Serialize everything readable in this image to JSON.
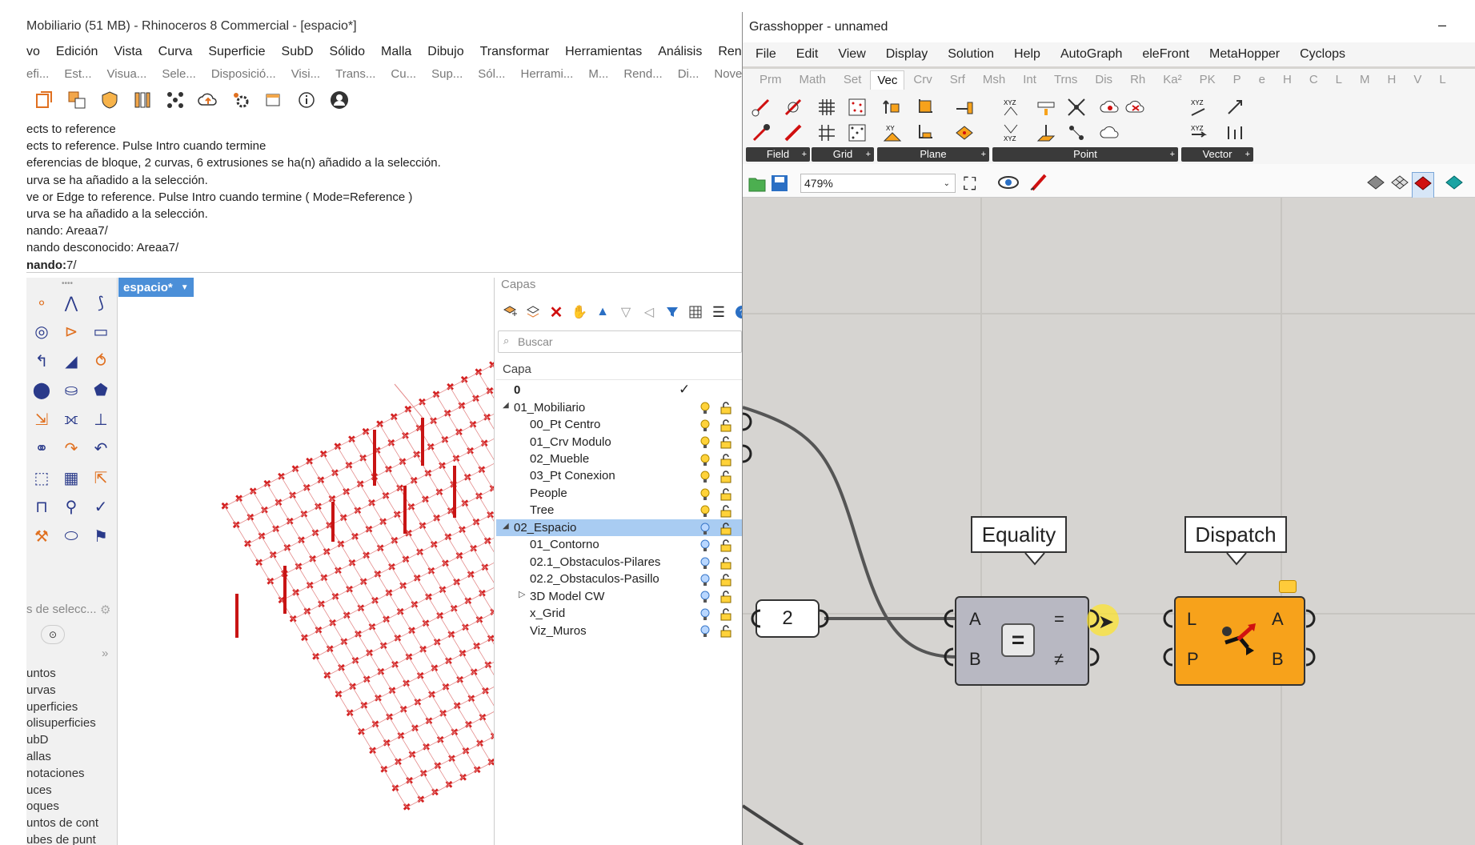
{
  "rhino": {
    "title": "Mobiliario (51 MB) - Rhinoceros 8 Commercial - [espacio*]",
    "menu": [
      "vo",
      "Edición",
      "Vista",
      "Curva",
      "Superficie",
      "SubD",
      "Sólido",
      "Malla",
      "Dibujo",
      "Transformar",
      "Herramientas",
      "Análisis",
      "Renderizac"
    ],
    "toolbar_tabs": [
      "efi...",
      "Est...",
      "Visua...",
      "Sele...",
      "Disposició...",
      "Visi...",
      "Trans...",
      "Cu...",
      "Sup...",
      "Sól...",
      "Herrami...",
      "M...",
      "Rend...",
      "Di...",
      "Nove"
    ],
    "command_log": [
      "ects to reference",
      "ects to reference. Pulse Intro cuando termine",
      "eferencias de bloque, 2 curvas, 6 extrusiones se ha(n) añadido a la selección.",
      "urva se ha añadido a la selección.",
      "ve or Edge to reference. Pulse Intro cuando termine ( Mode=Reference )",
      "urva se ha añadido a la selección.",
      "nando: Areaa7/",
      "nando desconocido: Areaa7/"
    ],
    "command_prompt_label": "nando:",
    "command_prompt_value": "7/",
    "viewport_tab": "espacio*",
    "selection_filter_header": "s de selecc...",
    "selection_items": [
      "untos",
      "urvas",
      "uperficies",
      "olisuperficies",
      "ubD",
      "allas",
      "notaciones",
      "uces",
      "oques",
      "untos de cont",
      "ubes de punt"
    ]
  },
  "layers": {
    "panel_title": "Capas",
    "search_placeholder": "Buscar",
    "column_header": "Capa",
    "rows": [
      {
        "name": "0",
        "current": true
      },
      {
        "name": "01_Mobiliario",
        "expanded": true
      },
      {
        "name": "00_Pt Centro"
      },
      {
        "name": "01_Crv Modulo"
      },
      {
        "name": "02_Mueble"
      },
      {
        "name": "03_Pt Conexion"
      },
      {
        "name": "People"
      },
      {
        "name": "Tree"
      },
      {
        "name": "02_Espacio",
        "expanded": true,
        "selected": true
      },
      {
        "name": "01_Contorno"
      },
      {
        "name": "02.1_Obstaculos-Pilares"
      },
      {
        "name": "02.2_Obstaculos-Pasillo"
      },
      {
        "name": "3D Model CW",
        "collapsed": true
      },
      {
        "name": "x_Grid"
      },
      {
        "name": "Viz_Muros"
      }
    ],
    "checkmark": "✓"
  },
  "grasshopper": {
    "title": "Grasshopper - unnamed",
    "minimize_glyph": "–",
    "menu": [
      "File",
      "Edit",
      "View",
      "Display",
      "Solution",
      "Help",
      "AutoGraph",
      "eleFront",
      "MetaHopper",
      "Cyclops"
    ],
    "tabs": [
      "Prm",
      "Math",
      "Set",
      "Vec",
      "Crv",
      "Srf",
      "Msh",
      "Int",
      "Trns",
      "Dis",
      "Rh",
      "Ka²",
      "PK",
      "P",
      "e",
      "H",
      "C",
      "L",
      "M",
      "H",
      "V",
      "L"
    ],
    "active_tab": "Vec",
    "ribbon_groups": [
      "Field",
      "Grid",
      "Plane",
      "Point",
      "Vector"
    ],
    "zoom": "479%",
    "slider_value": "2",
    "equality": {
      "label": "Equality",
      "in_a": "A",
      "in_b": "B",
      "out_eq": "=",
      "out_neq": "≠"
    },
    "dispatch": {
      "label": "Dispatch",
      "in_l": "L",
      "in_p": "P",
      "out_a": "A",
      "out_b": "B"
    }
  },
  "colors": {
    "accent_blue": "#4b8fd8",
    "gh_canvas": "#d6d4d1",
    "dispatch_orange": "#f7a21b",
    "equality_gray": "#b8b8c2",
    "grid_red": "#d42020"
  }
}
